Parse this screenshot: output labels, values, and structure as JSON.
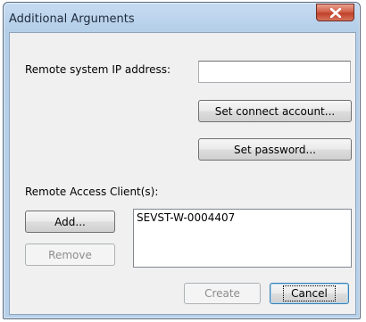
{
  "window": {
    "title": "Additional Arguments",
    "close_glyph": "X"
  },
  "remote_ip": {
    "label": "Remote system IP address:",
    "value": ""
  },
  "buttons": {
    "set_connect_account": "Set connect account...",
    "set_password": "Set password...",
    "add": "Add...",
    "remove": "Remove",
    "create": "Create",
    "cancel": "Cancel"
  },
  "clients": {
    "label": "Remote Access Client(s):",
    "items": [
      "SEVST-W-0004407"
    ]
  }
}
